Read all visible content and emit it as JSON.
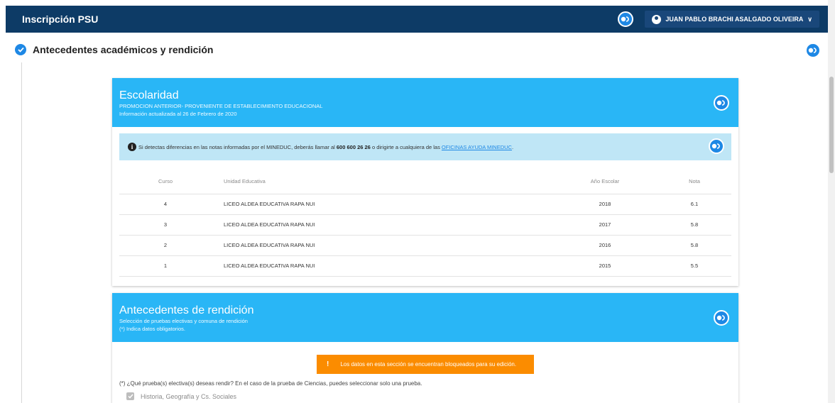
{
  "topbar": {
    "app_title": "Inscripción PSU",
    "user_name": "JUAN PABLO BRACHI ASALGADO OLIVEIRA"
  },
  "section": {
    "title": "Antecedentes académicos y rendición"
  },
  "escolaridad": {
    "title": "Escolaridad",
    "subtitle": "PROMOCION ANTERIOR- PROVENIENTE DE ESTABLECIMIENTO EDUCACIONAL",
    "updated": "Información actualizada al 26 de Febrero de 2020",
    "alert": {
      "text_before": "Si detectas diferencias en las notas informadas por el MINEDUC, deberás llamar al ",
      "phone": "600 600 26 26",
      "text_middle": " o dirigirte a cualquiera de las ",
      "link": "OFICINAS AYUDA MINEDUC",
      "text_after": "."
    },
    "columns": [
      "Curso",
      "Unidad Educativa",
      "Año Escolar",
      "Nota"
    ],
    "rows": [
      [
        "4",
        "LICEO ALDEA EDUCATIVA RAPA NUI",
        "2018",
        "6.1"
      ],
      [
        "3",
        "LICEO ALDEA EDUCATIVA RAPA NUI",
        "2017",
        "5.8"
      ],
      [
        "2",
        "LICEO ALDEA EDUCATIVA RAPA NUI",
        "2016",
        "5.8"
      ],
      [
        "1",
        "LICEO ALDEA EDUCATIVA RAPA NUI",
        "2015",
        "5.5"
      ]
    ]
  },
  "rendicion": {
    "title": "Antecedentes de rendición",
    "subtitle": "Selección de pruebas electivas y comuna de rendición",
    "note": "(*) Indica datos obligatorios.",
    "warning": "Los datos en esta sección se encuentran bloqueados para su edición.",
    "question": "(*) ¿Qué prueba(s) electiva(s) deseas rendir? En el caso de la prueba de Ciencias, puedes seleccionar solo una prueba.",
    "option_1": "Historia, Geografía y Cs. Sociales"
  },
  "colors": {
    "topbar": "#0d3b66",
    "card_header": "#29b6f6",
    "alert_bg": "#bfe6f6",
    "warning": "#fb8c00",
    "accent": "#1e88e5"
  },
  "icons": [
    "accessibility-icon",
    "user-circle-icon",
    "chevron-down-icon",
    "check-circle-icon",
    "info-icon",
    "exclamation-icon",
    "checkbox-icon"
  ]
}
